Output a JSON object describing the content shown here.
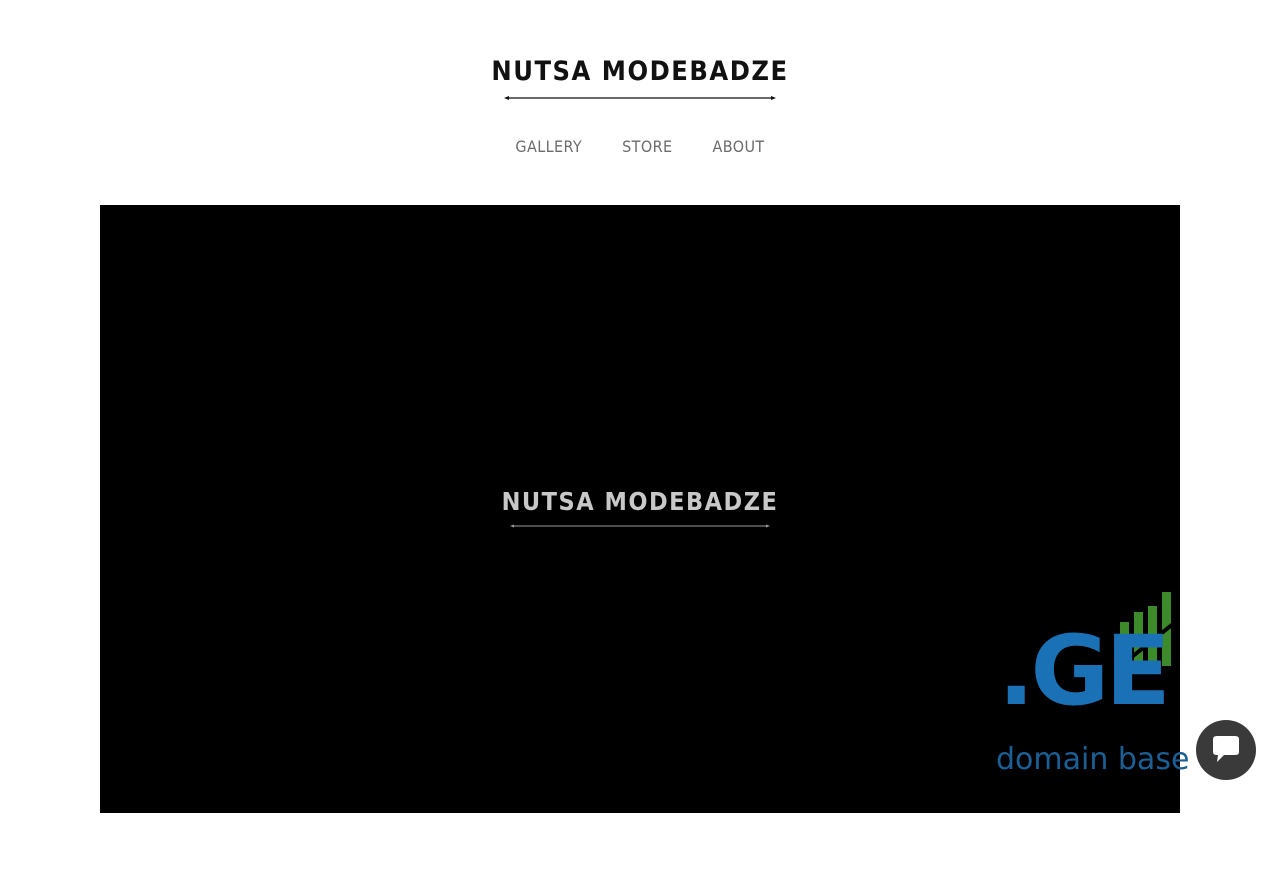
{
  "header": {
    "site_title": "NUTSA MODEBADZE"
  },
  "nav": {
    "items": [
      {
        "label": "GALLERY"
      },
      {
        "label": "STORE"
      },
      {
        "label": "ABOUT"
      }
    ]
  },
  "video": {
    "title": "NUTSA MODEBADZE"
  },
  "badge": {
    "ge_text": ".GE",
    "sub_text": "domain base"
  },
  "chat": {
    "icon": "chat-bubble-icon"
  },
  "colors": {
    "background": "#ffffff",
    "video_background": "#000000",
    "badge_blue": "#1b71b5",
    "badge_green": "#3c8a2a",
    "chat_button": "#3a3a3a"
  }
}
